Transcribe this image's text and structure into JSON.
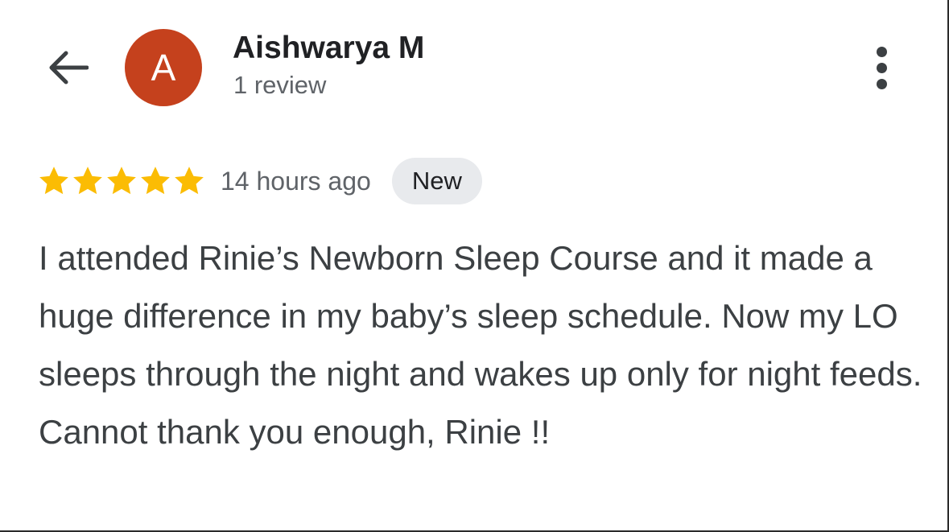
{
  "header": {
    "author_name": "Aishwarya M",
    "review_count": "1 review",
    "avatar_letter": "A",
    "avatar_color": "#c5411d"
  },
  "icons": {
    "back": "arrow-left-icon",
    "more": "more-vert-icon",
    "star": "star-icon"
  },
  "review": {
    "rating": 5,
    "max_rating": 5,
    "star_color": "#fbbc04",
    "time_ago": "14 hours ago",
    "badge": "New",
    "text": "I attended Rinie’s Newborn Sleep Course and it made a huge difference in my baby’s sleep schedule. Now my LO sleeps through the night and wakes up only for night feeds. Cannot thank you enough, Rinie !!"
  }
}
